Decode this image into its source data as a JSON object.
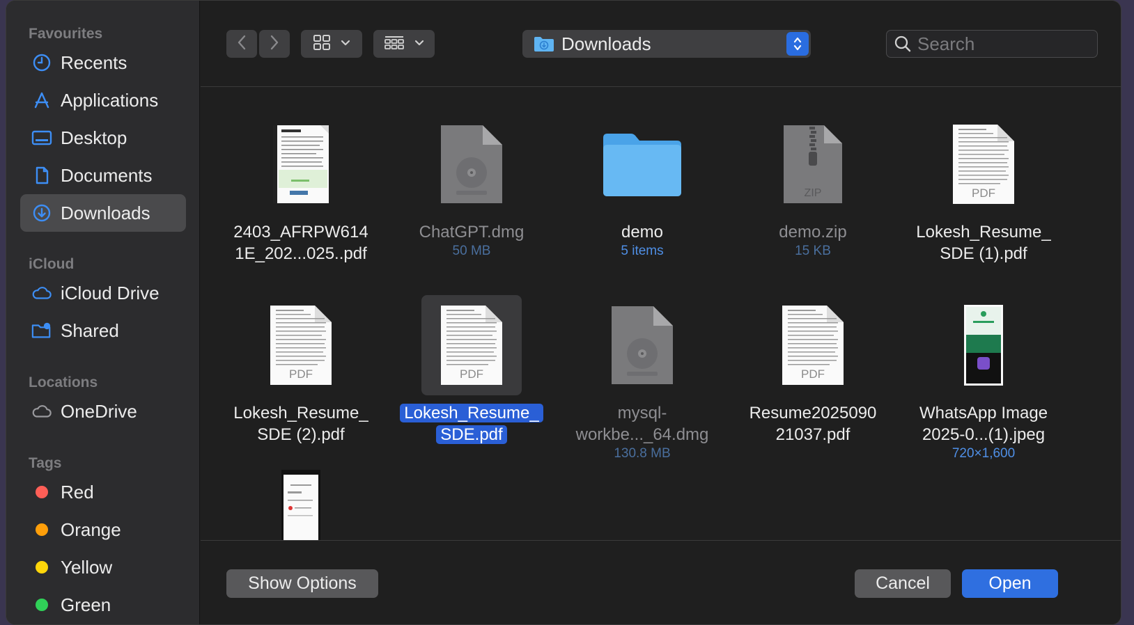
{
  "sidebar": {
    "sections": {
      "favourites": "Favourites",
      "icloud": "iCloud",
      "locations": "Locations",
      "tags": "Tags"
    },
    "favourites": [
      {
        "label": "Recents",
        "icon": "clock-icon"
      },
      {
        "label": "Applications",
        "icon": "applications-icon"
      },
      {
        "label": "Desktop",
        "icon": "desktop-icon"
      },
      {
        "label": "Documents",
        "icon": "document-icon"
      },
      {
        "label": "Downloads",
        "icon": "download-icon",
        "selected": true
      }
    ],
    "icloud": [
      {
        "label": "iCloud Drive",
        "icon": "cloud-icon"
      },
      {
        "label": "Shared",
        "icon": "shared-folder-icon"
      }
    ],
    "locations": [
      {
        "label": "OneDrive",
        "icon": "cloud-icon"
      }
    ],
    "tags": [
      {
        "label": "Red",
        "color": "#ff5f57"
      },
      {
        "label": "Orange",
        "color": "#ff9f0a"
      },
      {
        "label": "Yellow",
        "color": "#ffd60a"
      },
      {
        "label": "Green",
        "color": "#30d158"
      }
    ]
  },
  "toolbar": {
    "path": "Downloads",
    "search_placeholder": "Search"
  },
  "files": [
    {
      "name": "2403_AFRPW614\n1E_202...025..pdf",
      "meta": "",
      "kind": "form-pdf"
    },
    {
      "name": "ChatGPT.dmg",
      "meta": "50 MB",
      "kind": "dmg",
      "dim": true
    },
    {
      "name": "demo",
      "meta": "5 items",
      "kind": "folder"
    },
    {
      "name": "demo.zip",
      "meta": "15 KB",
      "kind": "zip",
      "dim": true
    },
    {
      "name": "Lokesh_Resume_\nSDE (1).pdf",
      "meta": "",
      "kind": "pdf"
    },
    {
      "name": "Lokesh_Resume_\nSDE (2).pdf",
      "meta": "",
      "kind": "pdf"
    },
    {
      "name": "Lokesh_Resume_\nSDE.pdf",
      "meta": "",
      "kind": "pdf",
      "selected": true
    },
    {
      "name": "mysql-\nworkbe..._64.dmg",
      "meta": "130.8 MB",
      "kind": "dmg",
      "dim": true
    },
    {
      "name": "Resume2025090\n21037.pdf",
      "meta": "",
      "kind": "pdf"
    },
    {
      "name": "WhatsApp Image\n2025-0...(1).jpeg",
      "meta": "720×1,600",
      "kind": "phone-green"
    },
    {
      "name": "",
      "meta": "",
      "kind": "phone-white"
    }
  ],
  "footer": {
    "show_options": "Show Options",
    "cancel": "Cancel",
    "open": "Open"
  }
}
